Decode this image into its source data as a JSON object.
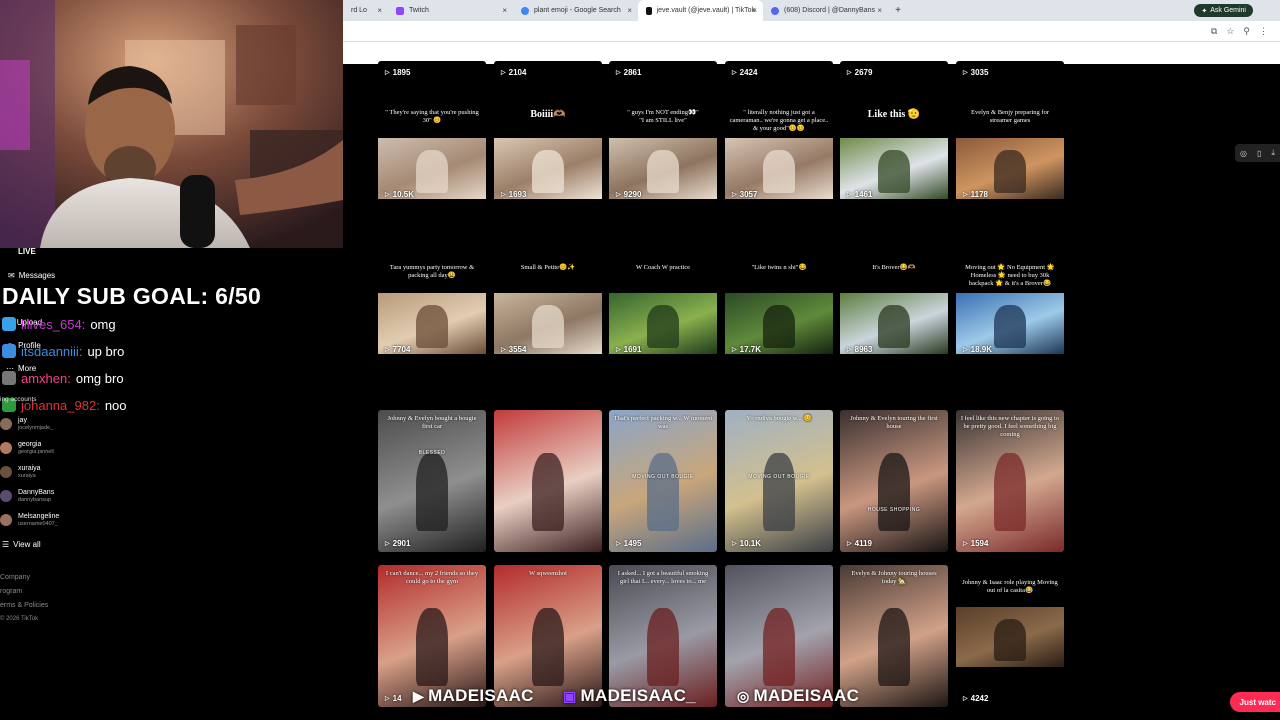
{
  "browser": {
    "tabs": [
      {
        "title": "rd Lo",
        "favicon": "#9b59b6",
        "active": false
      },
      {
        "title": "Twitch",
        "favicon": "#9146ff",
        "active": false
      },
      {
        "title": "plant emoji - Google Search",
        "favicon": "#4285f4",
        "active": false
      },
      {
        "title": "jeve.vault (@jeve.vault) | TikTok",
        "favicon": "#111111",
        "active": true
      },
      {
        "title": "(608) Discord | @DannyBans",
        "favicon": "#5865f2",
        "active": false
      }
    ],
    "close_glyph": "×",
    "new_tab_glyph": "+",
    "gemini_label": "Ask Gemini"
  },
  "grid": {
    "rows": [
      {
        "top_counts": [
          "1895",
          "2104",
          "2861",
          "2424",
          "2679",
          "3035"
        ],
        "captions": [
          "\" They're saying that you're pushing 30\" 😊",
          "Boiiii🫶🏽",
          "\" guys I'm NOT ending👀\"\n\"I am STILL live\"",
          "\" literally nothing just got a cameraman.. we're gonna get a place.. & your good\"😊😊",
          "Like this 🫡",
          "Evelyn & Benjy preparing for streamer games"
        ],
        "views": [
          "10.5K",
          "1693",
          "9290",
          "3057",
          "1461",
          "1178"
        ]
      },
      {
        "captions": [
          "Tara yummys party tomorrow & packing all day😩",
          "Small & Petite😊✨",
          "W Coach W practice",
          "\"Like twins n shi\"😂",
          "It's Brover😂🫶🏽",
          "Moving out 🌟 No Equipment 🌟 Homeless 🌟 need to buy 30k backpack 🌟 & it's a Brover😂"
        ],
        "views": [
          "7704",
          "3554",
          "1691",
          "17.7K",
          "8963",
          "18.9K"
        ]
      },
      {
        "captions": [
          "Johnny & Evelyn bought a bougie first car",
          "",
          "That's perfect packing w... W moment was",
          "Yo rndiva bougie w... 😊",
          "Johnny & Evelyn touring the first house",
          "I feel like this new chapter is going to be pretty good. I feel something big coming"
        ],
        "stickers": [
          "BLESSED",
          "",
          "MOVING OUT BOUGIE",
          "MOVING OUT BOUGIE",
          "HOUSE SHOPPING",
          ""
        ],
        "views": [
          "2901",
          "",
          "1495",
          "10.1K",
          "4119",
          "1594"
        ]
      },
      {
        "captions": [
          "I can't dance... my 2 friends so they could go to the gym",
          "W sqweenshot",
          "I asked... I got a beautiful smoking girl that I... every... loves to... me",
          "",
          "Evelyn & Johnny touring houses today 🏡",
          "Johnny & Isaac role playing Moving out of la casita😂"
        ],
        "views": [
          "14",
          "",
          "",
          "",
          "",
          "4242"
        ]
      }
    ]
  },
  "overlay": {
    "live_label": "LIVE",
    "daily_goal": "DAILY SUB GOAL: 6/50",
    "chat": [
      {
        "user": "lilives_654:",
        "msg": "omg",
        "color": "#c53bd3",
        "badge": "#36a3e8"
      },
      {
        "user": "itsdaanniii:",
        "msg": "up bro",
        "color": "#3d8de0",
        "badge": "#3d8de0"
      },
      {
        "user": "amxhen:",
        "msg": "omg bro",
        "color": "#ff3d8a",
        "badge": "#777777"
      },
      {
        "user": "johanna_982:",
        "msg": "noo",
        "color": "#e0303a",
        "badge": "#2e9b3b"
      }
    ],
    "watermark": [
      "MADEISAAC",
      "MADEISAAC_",
      "MADEISAAC"
    ],
    "just_watched": "Just watc"
  },
  "sidebar": {
    "messages": "Messages",
    "upload": "Upload",
    "profile": "Profile",
    "more": "More",
    "following_header": "ing accounts",
    "accounts": [
      {
        "name": "jay",
        "handle": "jocelynmjade_"
      },
      {
        "name": "georgia",
        "handle": "georgia.pinnell"
      },
      {
        "name": "xuraiya",
        "handle": "xuraiya"
      },
      {
        "name": "DannyBans",
        "handle": "dannybansup"
      },
      {
        "name": "Melsangeline",
        "handle": "username0407_"
      }
    ],
    "view_all": "View all",
    "footer": [
      "Company",
      "rogram",
      "erms & Policies",
      "© 2026 TikTok"
    ]
  },
  "colors": {
    "tiktok_red": "#fe2c55",
    "chrome_tabbar": "#dfe3ea"
  }
}
